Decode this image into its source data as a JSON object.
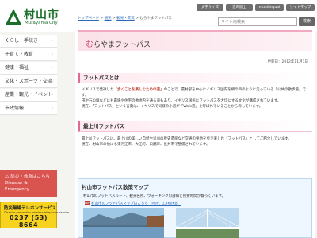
{
  "header": {
    "logo_title": "村山市",
    "logo_sub": "Murayama City",
    "links": [
      "文字サイズ",
      "音声読上",
      "multilingual",
      "サイトマップ"
    ],
    "search_placeholder": "サイト内検索",
    "search_button": "検索"
  },
  "sidebar": {
    "items": [
      {
        "label": "くらし・手続き"
      },
      {
        "label": "子育て・教育"
      },
      {
        "label": "健康・福祉"
      },
      {
        "label": "文化・スポーツ・交流"
      },
      {
        "label": "産業・観光・イベント"
      },
      {
        "label": "市政情報"
      }
    ],
    "disaster_line1": "防災・救急はこちら",
    "disaster_line2": "Disaster & Emergency",
    "radio_title": "防災無線テレホンサービス",
    "radio_sub": "Disaster prevention wireless telephone service",
    "radio_tel": "0237 (53) 8664"
  },
  "breadcrumb": [
    "トップページ",
    "観光",
    "観光・交流",
    "むらやまフットパス"
  ],
  "page": {
    "title_first": "む",
    "title_rest": "らやまフットパス",
    "updated": "更新日：2012年11月1日"
  },
  "sections": [
    {
      "heading": "フットパスとは",
      "text1": "イギリスで発祥した",
      "text_em": "「歩くことを楽しむための道」",
      "text2": "のことで、農村部を中心にイギリス国内を網の目のように走っている「公共の散歩道」です。",
      "text3": "田や石の塀などにも農場や住宅の敷地内を通る道もあり、イギリス国民にフットパスを大切にする文化が構成されています。",
      "text4": "現在、「フットパス」という言葉は、イギリスで同様の小道が「Walk道」と呼ばれていることから称しています。"
    },
    {
      "heading": "最上川フットパス",
      "text1": "最上川フットパスは、最上川の美しい自然や沿川の歴史遺産など交通の要地を歩き楽しむ「フットパス」としてご紹介しています。",
      "text2": "現在、村山市の他にも東河江市、大江町、白鷹町、長井市で整備されています。"
    }
  ],
  "map": {
    "heading": "村山市フットパス散策マップ",
    "text": "村山市のフットパスルート、観光名所、ウォーキングの詳細と所要時間が載っています。",
    "pdf_icon": "PDF",
    "pdf_link": "村山市のフットパスマップはこちら（PDF：1,460KB）"
  },
  "colors": {
    "brand": "#1b6f2a",
    "accent_pink": "#e06c96",
    "disaster_red": "#d9534f",
    "radio_yellow": "#f7d21e"
  }
}
